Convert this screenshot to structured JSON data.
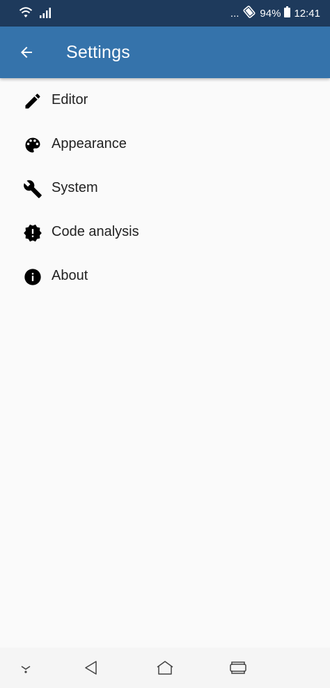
{
  "status_bar": {
    "dots": "...",
    "battery": "94%",
    "time": "12:41",
    "icons": [
      "wifi-icon",
      "signal-icon",
      "rotate-icon",
      "battery-icon"
    ]
  },
  "app_bar": {
    "title": "Settings",
    "back_icon": "arrow-left-icon"
  },
  "menu": {
    "items": [
      {
        "label": "Editor",
        "icon": "pencil-icon"
      },
      {
        "label": "Appearance",
        "icon": "palette-icon"
      },
      {
        "label": "System",
        "icon": "wrench-icon"
      },
      {
        "label": "Code analysis",
        "icon": "alert-decagram-icon"
      },
      {
        "label": "About",
        "icon": "info-icon"
      }
    ]
  },
  "nav_bar": {
    "icons": [
      "dropdown-icon",
      "back-triangle-icon",
      "home-icon",
      "recents-icon"
    ]
  },
  "colors": {
    "status_bar": "#1e3a5c",
    "app_bar": "#3573ab",
    "background": "#fafafa",
    "nav_bar": "#f5f5f5"
  }
}
